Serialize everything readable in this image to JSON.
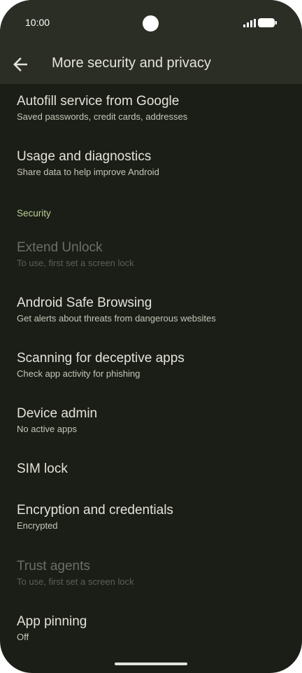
{
  "status_bar": {
    "time": "10:00"
  },
  "app_bar": {
    "title": "More security and privacy"
  },
  "items": [
    {
      "title": "Autofill service from Google",
      "subtitle": "Saved passwords, credit cards, addresses",
      "enabled": true
    },
    {
      "title": "Usage and diagnostics",
      "subtitle": "Share data to help improve Android",
      "enabled": true
    }
  ],
  "section_header": "Security",
  "security_items": [
    {
      "title": "Extend Unlock",
      "subtitle": "To use, first set a screen lock",
      "enabled": false
    },
    {
      "title": "Android Safe Browsing",
      "subtitle": "Get alerts about threats from dangerous websites",
      "enabled": true
    },
    {
      "title": "Scanning for deceptive apps",
      "subtitle": "Check app activity for phishing",
      "enabled": true
    },
    {
      "title": "Device admin",
      "subtitle": "No active apps",
      "enabled": true
    },
    {
      "title": "SIM lock",
      "subtitle": "",
      "enabled": true
    },
    {
      "title": "Encryption and credentials",
      "subtitle": "Encrypted",
      "enabled": true
    },
    {
      "title": "Trust agents",
      "subtitle": "To use, first set a screen lock",
      "enabled": false
    },
    {
      "title": "App pinning",
      "subtitle": "Off",
      "enabled": true
    }
  ],
  "colors": {
    "background": "#1b1d17",
    "app_bar": "#2b2e25",
    "text_primary": "#e4e3d9",
    "text_secondary": "#c4c7b8",
    "accent": "#bccf95",
    "disabled": "#6c6e66"
  },
  "icons": {
    "back": "arrow-back-icon",
    "signal": "cellular-signal-icon",
    "battery": "battery-icon",
    "camera": "front-camera-cutout"
  }
}
